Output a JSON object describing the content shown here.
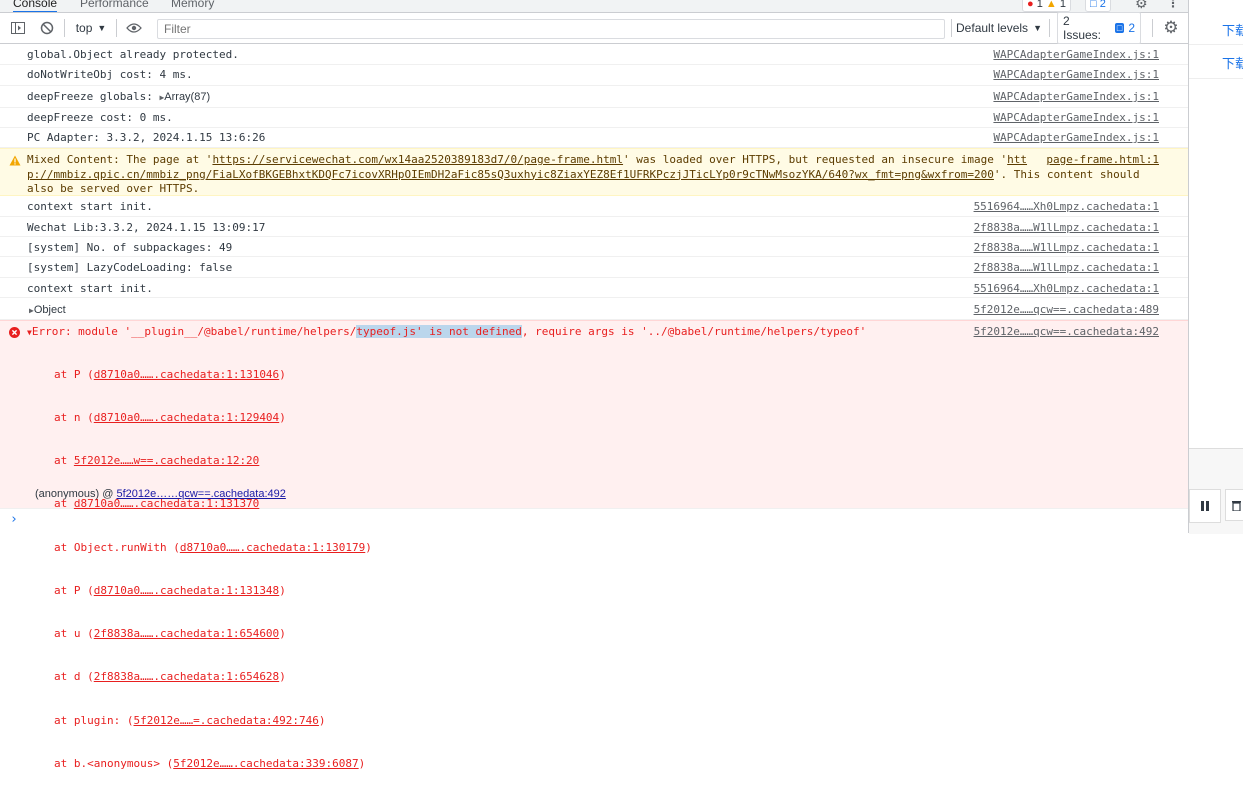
{
  "tabs": {
    "console": "Console",
    "performance": "Performance",
    "memory": "Memory"
  },
  "top_badges": {
    "errors": "1",
    "warnings": "1",
    "messages": "2"
  },
  "toolbar": {
    "context": "top",
    "filter_placeholder": "Filter",
    "levels": "Default levels",
    "issues_label": "2 Issues:",
    "issues_count": "2"
  },
  "logs": [
    {
      "text": "global.Object already protected.",
      "source": "WAPCAdapterGameIndex.js:1"
    },
    {
      "text": "doNotWriteObj cost: 4 ms.",
      "source": "WAPCAdapterGameIndex.js:1"
    },
    {
      "text": "deepFreeze globals: ",
      "expand": "Array(87)",
      "source": "WAPCAdapterGameIndex.js:1"
    },
    {
      "text": "deepFreeze cost: 0 ms.",
      "source": "WAPCAdapterGameIndex.js:1"
    },
    {
      "text": "PC Adapter: 3.3.2, 2024.1.15 13:6:26",
      "source": "WAPCAdapterGameIndex.js:1"
    }
  ],
  "warning": {
    "pre": "Mixed Content: The page at '",
    "url1": "https://servicewechat.com/wx14aa2520389183d7/0/page-frame.html",
    "mid": "' was loaded over HTTPS, but requested an insecure image '",
    "url2a": "htt",
    "url2b": "p://mmbiz.qpic.cn/mmbiz_png/FiaLXofBKGEBhxtKDQFc7icovXRHpOIEmDH2aFic85sQ3uxhyic8ZiaxYEZ8Ef1UFRKPczjJTicLYp0r9cTNwMsozYKA/640?wx_fmt=png&wxfrom=200",
    "post": "'. This content should",
    "line3": "also be served over HTTPS.",
    "source": "page-frame.html:1"
  },
  "logs2": [
    {
      "text": "context start init.",
      "source": "5516964……Xh0Lmpz.cachedata:1"
    },
    {
      "text": "Wechat Lib:3.3.2, 2024.1.15 13:09:17",
      "source": "2f8838a……W1lLmpz.cachedata:1"
    },
    {
      "text": "[system] No. of subpackages: 49",
      "source": "2f8838a……W1lLmpz.cachedata:1"
    },
    {
      "text": "[system] LazyCodeLoading: false",
      "source": "2f8838a……W1lLmpz.cachedata:1"
    },
    {
      "text": "context start init.",
      "source": "5516964……Xh0Lmpz.cachedata:1"
    },
    {
      "text": "Object",
      "source": "5f2012e……qcw==.cachedata:489"
    }
  ],
  "error": {
    "pre": "Error: module '__plugin__/@babel/runtime/helpers/",
    "hl": "typeof.js' is not defined",
    "post": ", require args is '../@babel/runtime/helpers/typeof'",
    "source": "5f2012e……qcw==.cachedata:492",
    "stack": [
      {
        "pre": "at P (",
        "link": "d8710a0…….cachedata:1:131046",
        "post": ")"
      },
      {
        "pre": "at n (",
        "link": "d8710a0…….cachedata:1:129404",
        "post": ")"
      },
      {
        "pre": "at ",
        "link": "5f2012e……w==.cachedata:12:20",
        "post": ""
      },
      {
        "pre": "at ",
        "link": "d8710a0…….cachedata:1:131370",
        "post": ""
      },
      {
        "pre": "at Object.runWith (",
        "link": "d8710a0…….cachedata:1:130179",
        "post": ")"
      },
      {
        "pre": "at P (",
        "link": "d8710a0…….cachedata:1:131348",
        "post": ")"
      },
      {
        "pre": "at u (",
        "link": "2f8838a…….cachedata:1:654600",
        "post": ")"
      },
      {
        "pre": "at d (",
        "link": "2f8838a…….cachedata:1:654628",
        "post": ")"
      },
      {
        "pre": "at plugin: (",
        "link": "5f2012e……=.cachedata:492:746",
        "post": ")"
      },
      {
        "pre": "at b.<anonymous> (",
        "link": "5f2012e…….cachedata:339:6087",
        "post": ")"
      }
    ],
    "anon_label": "(anonymous) @ ",
    "anon_link": "5f2012e……qcw==.cachedata:492"
  },
  "right_panel": {
    "download1": "下载",
    "download2": "下载"
  },
  "icons": [
    "dock-sidebar-icon",
    "clear-console-icon",
    "eye-icon",
    "settings-icon",
    "warning-icon",
    "error-icon",
    "triangle-right-icon",
    "triangle-down-icon",
    "prompt-chevron-icon",
    "pause-icon",
    "trash-icon",
    "more-vert-icon",
    "chat-icon"
  ],
  "colors": {
    "error_bg": "#fff0f0",
    "error_text": "#e81f1f",
    "warning_bg": "#fffbe5",
    "accent": "#1a73e8"
  }
}
